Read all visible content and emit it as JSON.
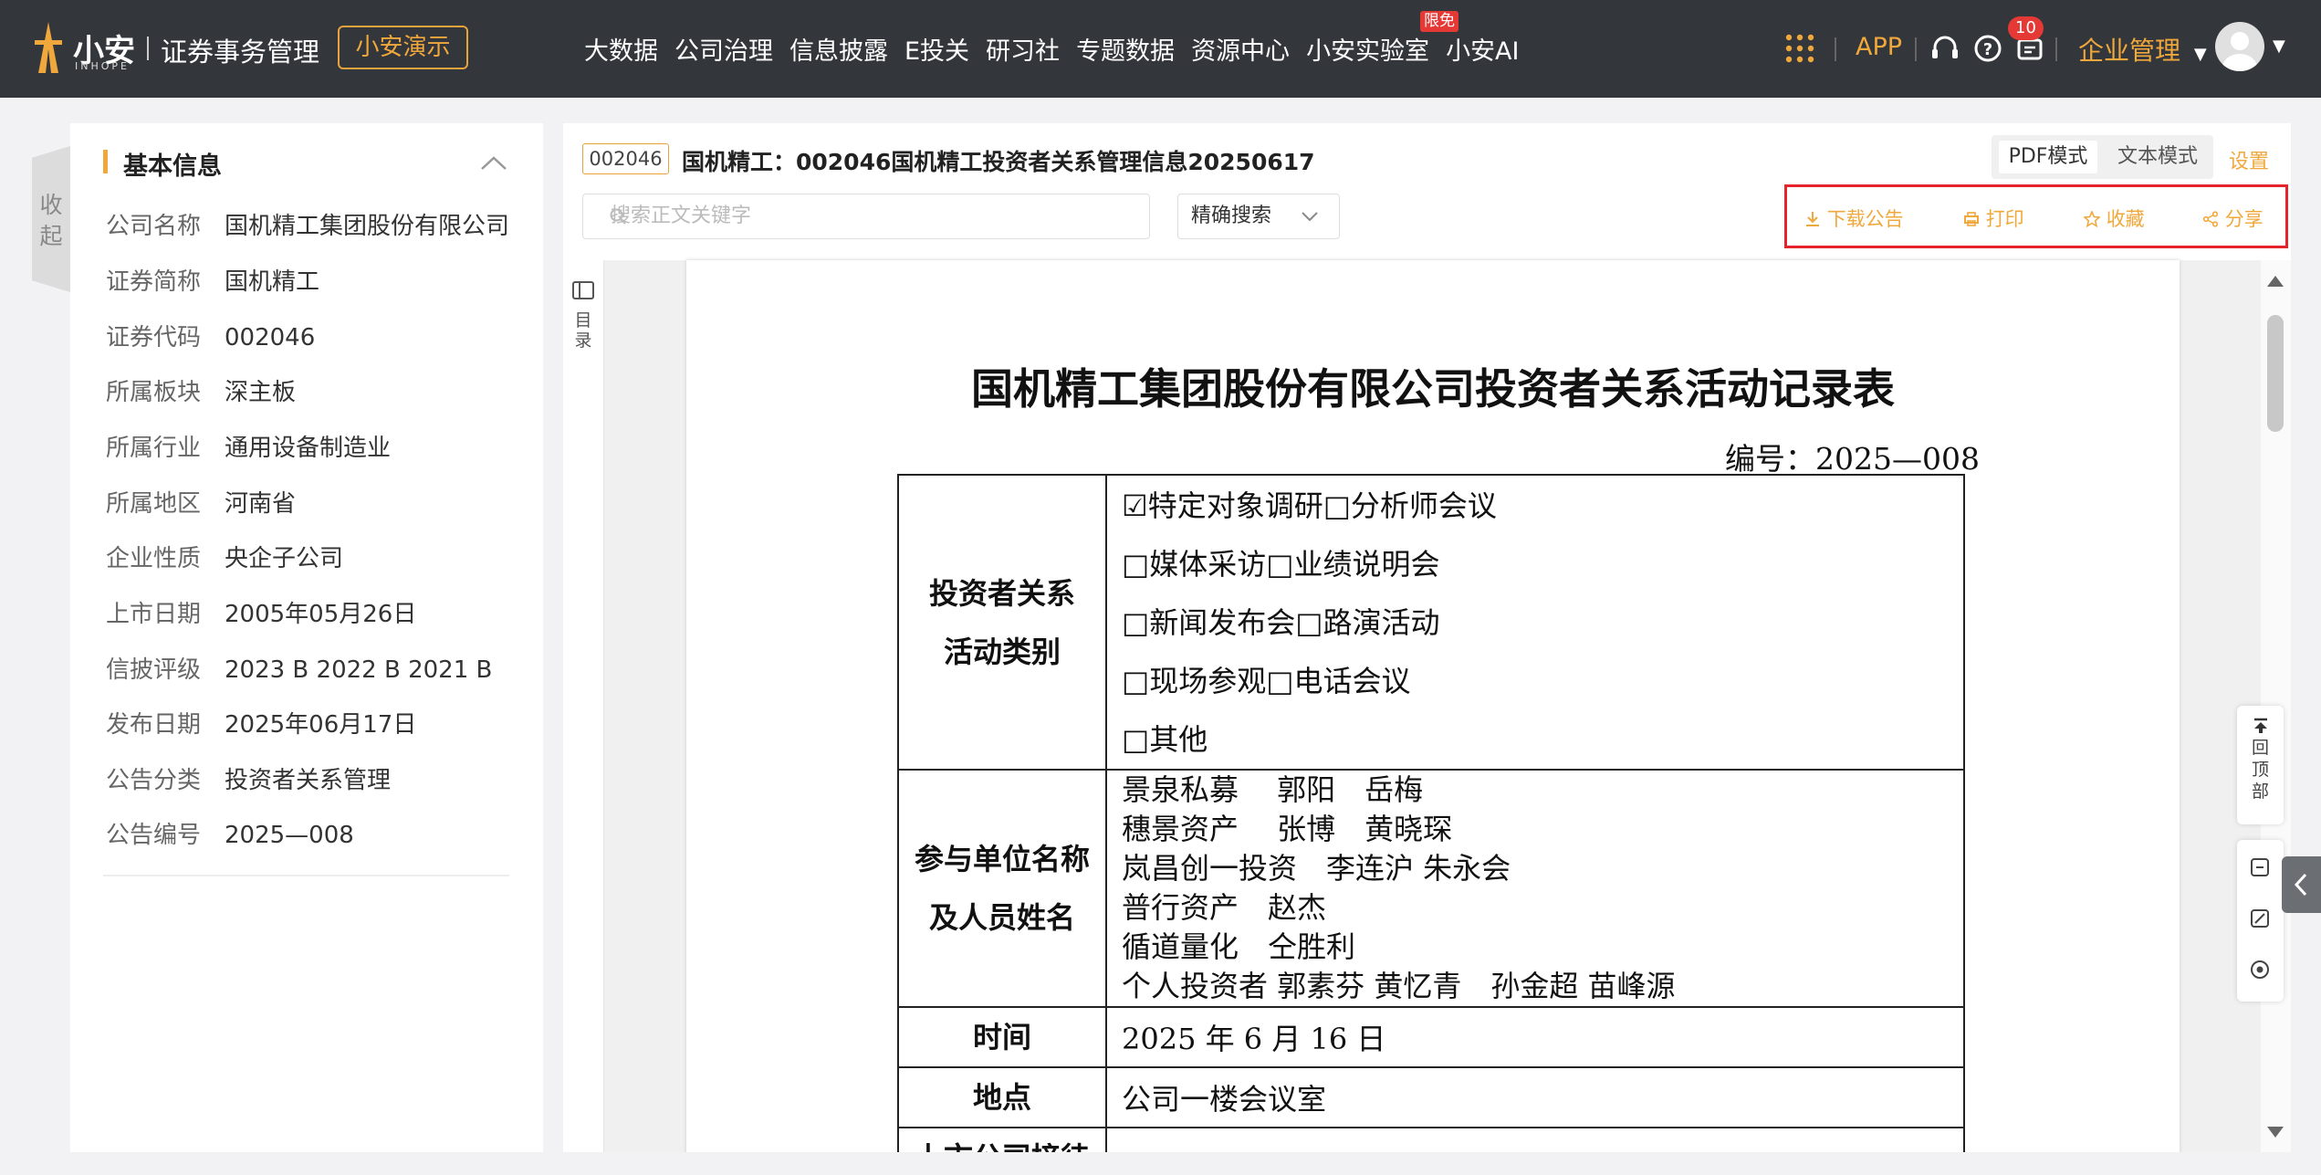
{
  "header": {
    "brand_name": "小安",
    "brand_en": "INHOPE",
    "product": "证券事务管理",
    "demo_button": "小安演示",
    "nav": [
      "大数据",
      "公司治理",
      "信息披露",
      "E投关",
      "研习社",
      "专题数据",
      "资源中心",
      "小安实验室",
      "小安AI"
    ],
    "free_badge": "限免",
    "app_label": "APP",
    "notification_count": "10",
    "corp_menu": "企业管理",
    "accent_color": "#f0a83c"
  },
  "left_panel": {
    "collapse_label": "收起",
    "section_title": "基本信息",
    "rows": [
      {
        "k": "公司名称",
        "v": "国机精工集团股份有限公司"
      },
      {
        "k": "证券简称",
        "v": "国机精工"
      },
      {
        "k": "证券代码",
        "v": "002046"
      },
      {
        "k": "所属板块",
        "v": "深主板"
      },
      {
        "k": "所属行业",
        "v": "通用设备制造业"
      },
      {
        "k": "所属地区",
        "v": "河南省"
      },
      {
        "k": "企业性质",
        "v": "央企子公司"
      },
      {
        "k": "上市日期",
        "v": "2005年05月26日"
      },
      {
        "k": "信披评级",
        "v": "2023 B  2022 B  2021 B"
      },
      {
        "k": "发布日期",
        "v": "2025年06月17日"
      },
      {
        "k": "公告分类",
        "v": "投资者关系管理"
      },
      {
        "k": "公告编号",
        "v": "2025—008"
      }
    ]
  },
  "main": {
    "code": "002046",
    "title": "国机精工：002046国机精工投资者关系管理信息20250617",
    "mode_pdf": "PDF模式",
    "mode_text": "文本模式",
    "settings": "设置",
    "search_placeholder": "搜索正文关键字",
    "search_mode": "精确搜索",
    "actions": {
      "download": "下载公告",
      "print": "打印",
      "favorite": "收藏",
      "share": "分享"
    },
    "toc_label": "目录"
  },
  "document": {
    "title": "国机精工集团股份有限公司投资者关系活动记录表",
    "number": "编号：2025—008",
    "row1_label_a": "投资者关系",
    "row1_label_b": "活动类别",
    "row1_lines": [
      "☑特定对象调研□分析师会议",
      "□媒体采访□业绩说明会",
      "□新闻发布会□路演活动",
      "□现场参观□电话会议",
      "□其他"
    ],
    "row2_label_a": "参与单位名称",
    "row2_label_b": "及人员姓名",
    "row2_lines": [
      "景泉私募　  郭阳　岳梅",
      "穗景资产　  张博　黄晓琛",
      "岚昌创一投资　李连沪  朱永会",
      "普行资产　赵杰",
      "循道量化　仝胜利",
      "个人投资者  郭素芬  黄忆青　孙金超  苗峰源"
    ],
    "time_label": "时间",
    "time_value": "2025 年 6 月 16 日",
    "place_label": "地点",
    "place_value": "公司一楼会议室",
    "reception_label": "上市公司接待"
  },
  "side_tools": {
    "back_top": "回顶部"
  }
}
